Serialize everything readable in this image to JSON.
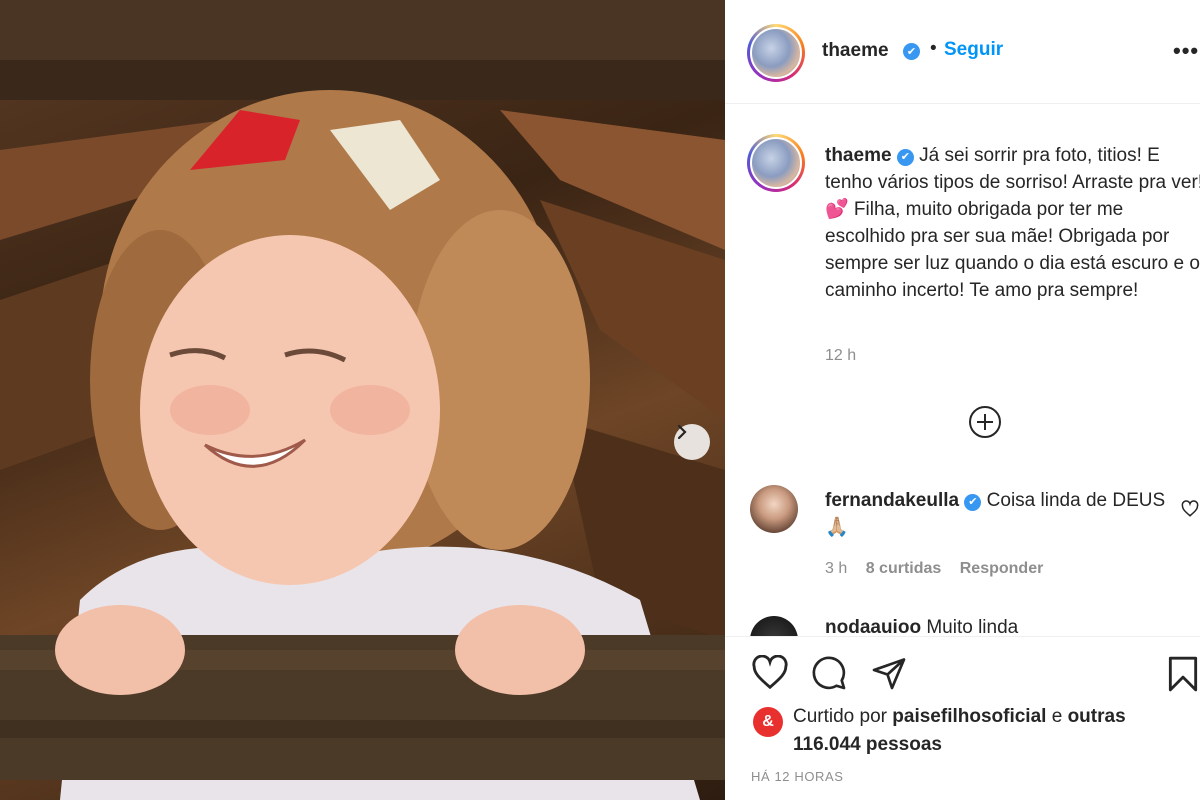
{
  "post": {
    "username": "thaeme",
    "follow_label": "Seguir",
    "separator": "•",
    "more_label": "•••"
  },
  "caption": {
    "username": "thaeme",
    "text": "Já sei sorrir pra foto, titios! E tenho vários tipos de sorriso! Arraste pra ver! 💕 Filha, muito obrigada por ter me escolhido pra ser sua mãe! Obrigada por sempre ser luz quando o dia está escuro e o caminho incerto! Te amo pra sempre!",
    "time": "12 h"
  },
  "comments": [
    {
      "username": "fernandakeulla",
      "text": "Coisa linda de DEUS 🙏🏼",
      "time": "3 h",
      "likes": "8 curtidas",
      "reply_label": "Responder"
    },
    {
      "username": "nodaauioo",
      "text": "Muito linda"
    }
  ],
  "likes": {
    "prefix": "Curtido por",
    "user": "paisefilhosoficial",
    "connector": "e",
    "others": "outras 116.044 pessoas",
    "badge": "&"
  },
  "date": "HÁ 12 HORAS",
  "colors": {
    "link_blue": "#0095f6",
    "verified_blue": "#3897f0",
    "muted": "#8e8e8e",
    "badge_red": "#e8312f"
  },
  "icons": [
    "chevron-right-icon",
    "verified-icon",
    "more-icon",
    "plus-circle-icon",
    "heart-icon",
    "comment-icon",
    "share-icon",
    "bookmark-icon"
  ]
}
